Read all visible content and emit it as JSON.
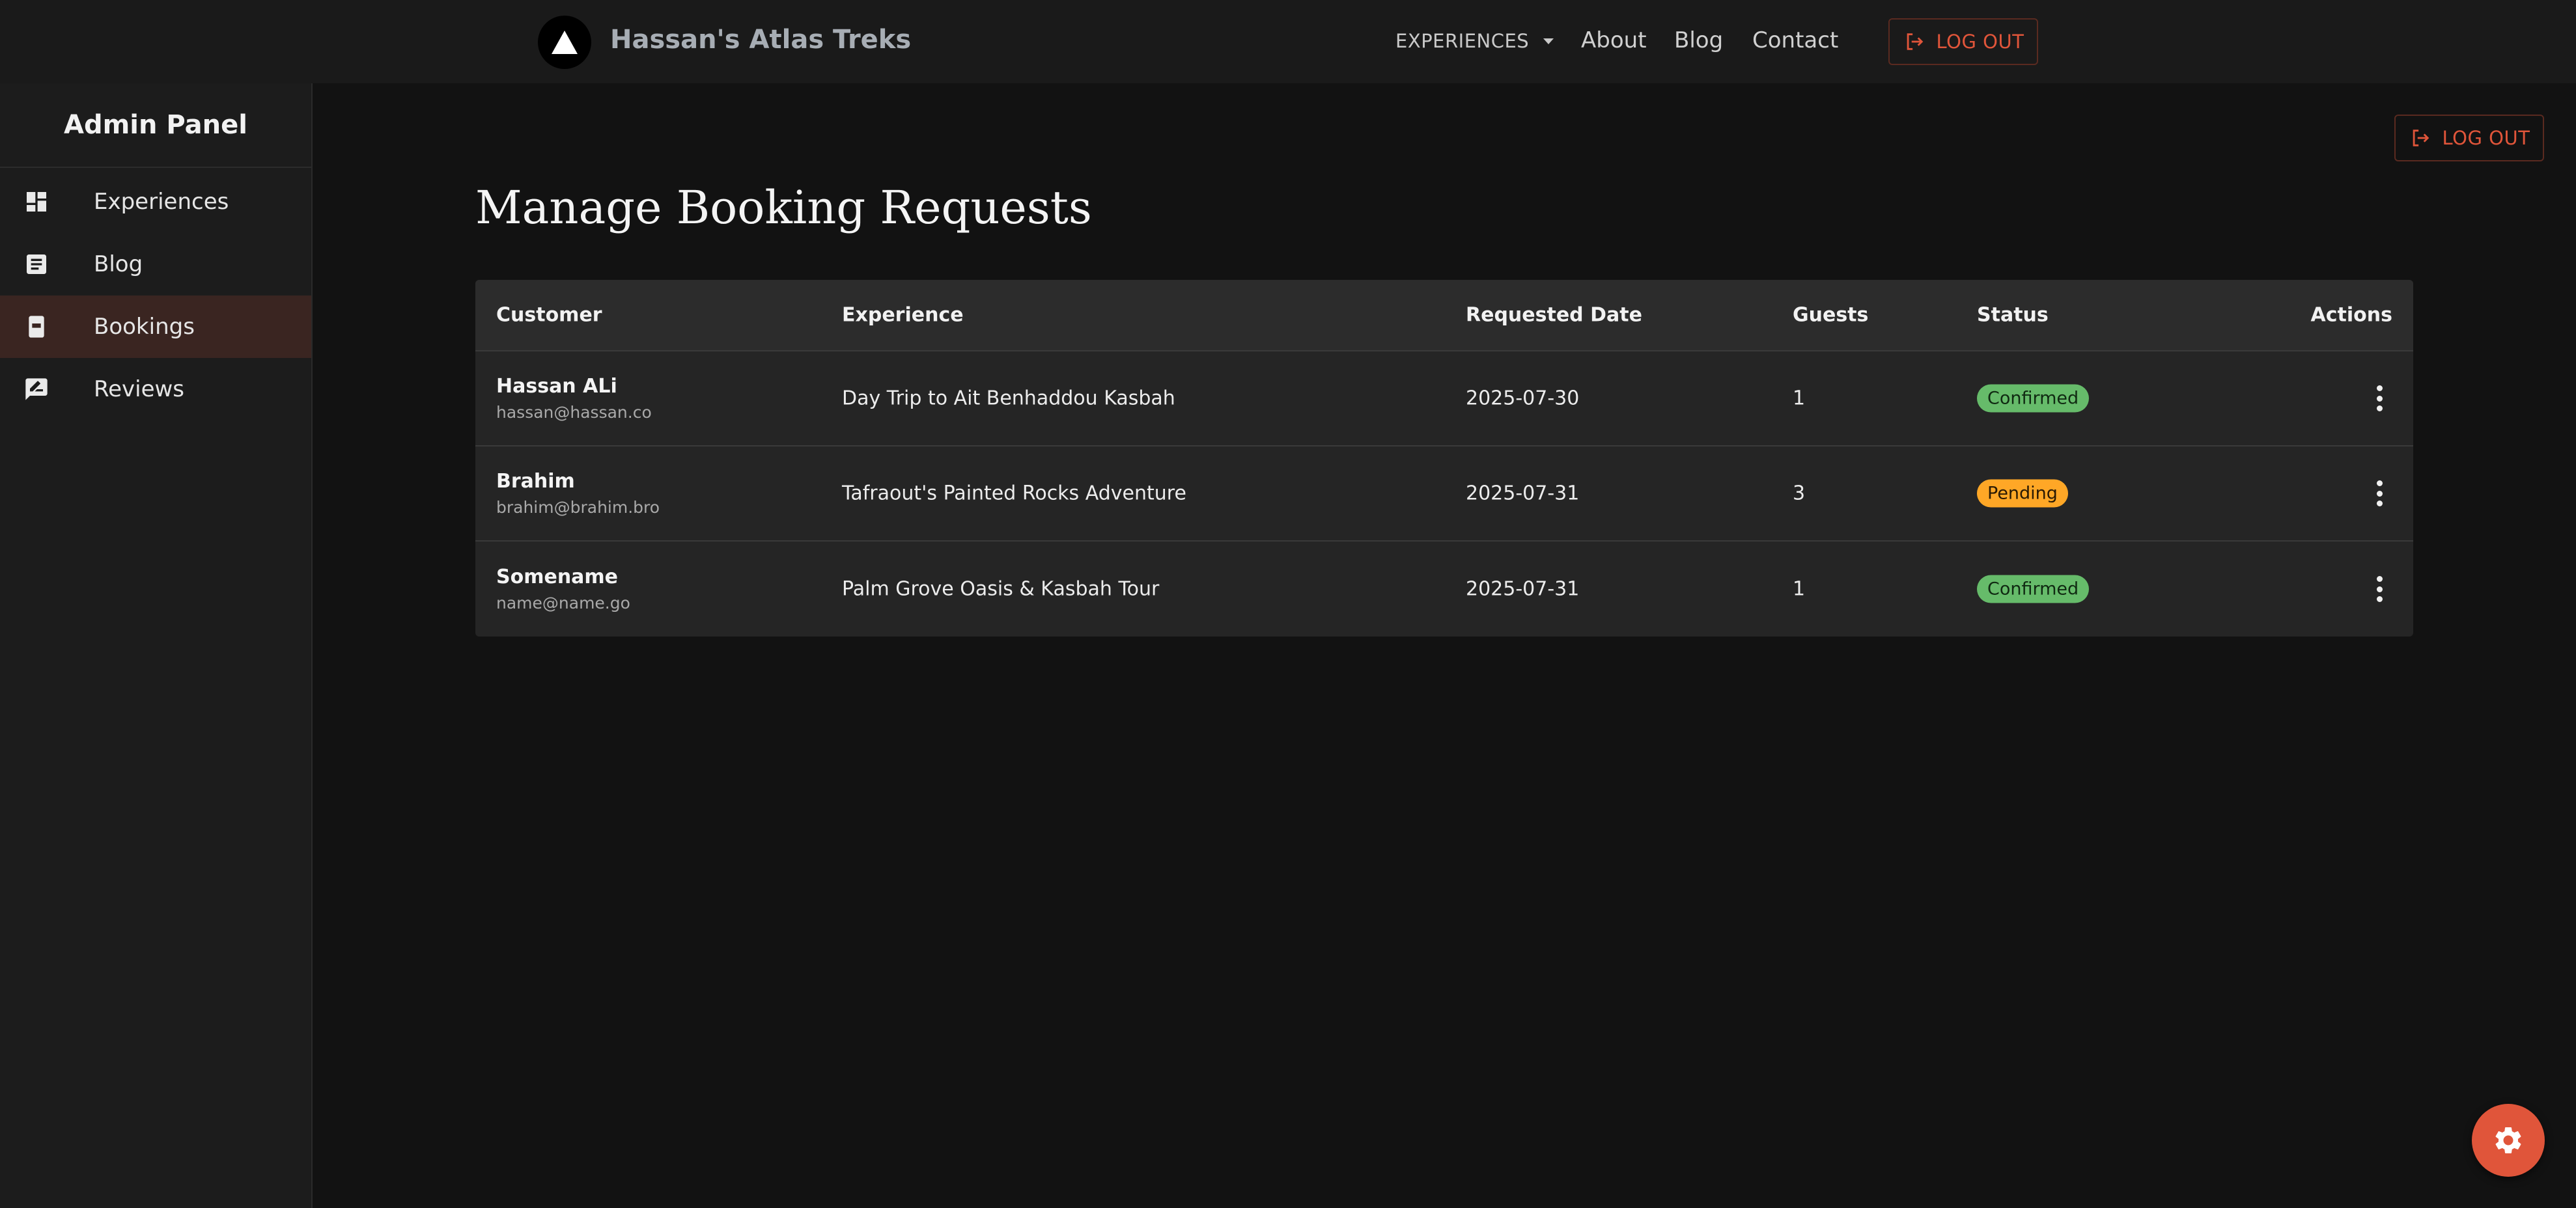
{
  "header": {
    "brand_name": "Hassan's Atlas Treks",
    "nav": {
      "experiences": "EXPERIENCES",
      "about": "About",
      "blog": "Blog",
      "contact": "Contact"
    },
    "logout_label": "LOG OUT"
  },
  "sidebar": {
    "title": "Admin Panel",
    "items": [
      {
        "label": "Experiences",
        "icon": "dashboard-icon"
      },
      {
        "label": "Blog",
        "icon": "article-icon"
      },
      {
        "label": "Bookings",
        "icon": "booking-icon",
        "active": true
      },
      {
        "label": "Reviews",
        "icon": "rate-review-icon"
      }
    ]
  },
  "main": {
    "logout_label": "LOG OUT",
    "page_title": "Manage Booking Requests",
    "table": {
      "headers": {
        "customer": "Customer",
        "experience": "Experience",
        "date": "Requested Date",
        "guests": "Guests",
        "status": "Status",
        "actions": "Actions"
      },
      "rows": [
        {
          "name": "Hassan ALi",
          "email": "hassan@hassan.co",
          "experience": "Day Trip to Ait Benhaddou Kasbah",
          "date": "2025-07-30",
          "guests": "1",
          "status": "Confirmed"
        },
        {
          "name": "Brahim",
          "email": "brahim@brahim.bro",
          "experience": "Tafraout's Painted Rocks Adventure",
          "date": "2025-07-31",
          "guests": "3",
          "status": "Pending"
        },
        {
          "name": "Somename",
          "email": "name@name.go",
          "experience": "Palm Grove Oasis & Kasbah Tour",
          "date": "2025-07-31",
          "guests": "1",
          "status": "Confirmed"
        }
      ]
    }
  },
  "colors": {
    "accent": "#e0553a",
    "confirmed": "#66bb6a",
    "pending": "#ffa726",
    "background": "#121212"
  }
}
